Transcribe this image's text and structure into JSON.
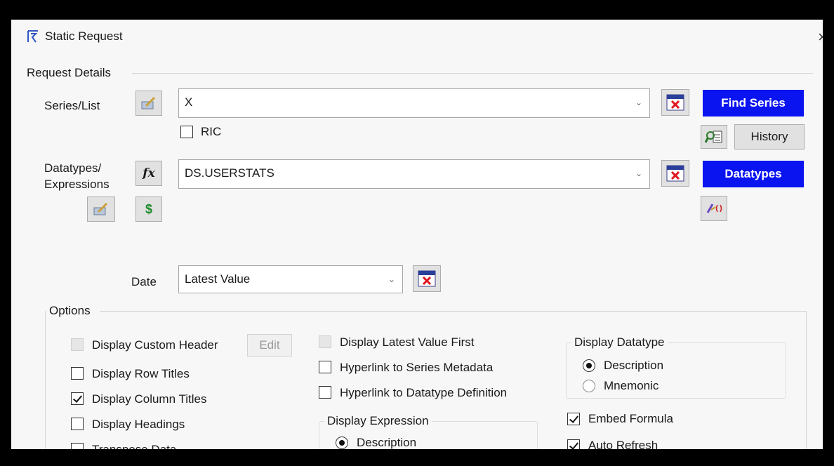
{
  "window": {
    "title": "Static Request",
    "close_glyph": "×"
  },
  "request_details": {
    "legend": "Request Details",
    "series": {
      "label": "Series/List",
      "value": "X",
      "ric_label": "RIC",
      "ric_checked": false,
      "find_button": "Find Series",
      "history_button": "History"
    },
    "datatypes": {
      "label_line1": "Datatypes/",
      "label_line2": "Expressions",
      "value": "DS.USERSTATS",
      "datatypes_button": "Datatypes",
      "fx_glyph": "fx",
      "dollar_glyph": "$"
    },
    "date": {
      "label": "Date",
      "value": "Latest Value"
    }
  },
  "options": {
    "legend": "Options",
    "col1": [
      {
        "label": "Display Custom Header",
        "checked": false,
        "disabled": true
      },
      {
        "label": "Display Row Titles",
        "checked": false,
        "disabled": false
      },
      {
        "label": "Display Column Titles",
        "checked": true,
        "disabled": false
      },
      {
        "label": "Display Headings",
        "checked": false,
        "disabled": false
      },
      {
        "label": "Transpose Data",
        "checked": false,
        "disabled": false
      }
    ],
    "edit_button": "Edit",
    "col2": [
      {
        "label": "Display Latest Value First",
        "checked": false,
        "disabled": true
      },
      {
        "label": "Hyperlink to Series Metadata",
        "checked": false,
        "disabled": false
      },
      {
        "label": "Hyperlink to Datatype Definition",
        "checked": false,
        "disabled": false
      }
    ],
    "display_expression": {
      "legend": "Display Expression",
      "options": [
        "Description"
      ],
      "selected": "Description"
    },
    "display_datatype": {
      "legend": "Display Datatype",
      "options": [
        "Description",
        "Mnemonic"
      ],
      "selected": "Description"
    },
    "col3": [
      {
        "label": "Embed Formula",
        "checked": true
      },
      {
        "label": "Auto Refresh",
        "checked": true
      }
    ]
  },
  "colors": {
    "accent_blue": "#0a14f0",
    "dialog_bg": "#f7f7f7",
    "frame": "#000000"
  },
  "icons": [
    "app-logo-icon",
    "close-icon",
    "series-picker-icon",
    "clear-series-icon",
    "fx-icon",
    "dollar-icon",
    "datatype-picker-icon",
    "clear-datatype-icon",
    "clear-date-icon",
    "search-list-icon",
    "expression-builder-icon",
    "chevron-down-icon"
  ]
}
